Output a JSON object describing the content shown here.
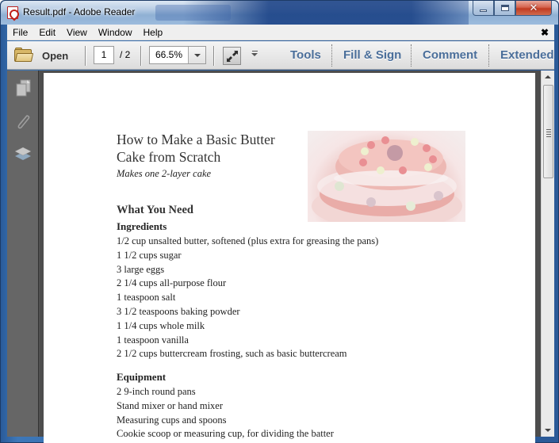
{
  "window": {
    "title": "Result.pdf - Adobe Reader",
    "controls": {
      "minimize": "minimize",
      "maximize": "maximize",
      "close": "✕"
    }
  },
  "menubar": {
    "items": [
      "File",
      "Edit",
      "View",
      "Window",
      "Help"
    ],
    "close_doc": "✖"
  },
  "toolbar": {
    "open_label": "Open",
    "page_current": "1",
    "page_total": "/ 2",
    "zoom_value": "66.5%",
    "pane_tabs": [
      "Tools",
      "Fill & Sign",
      "Comment",
      "Extended"
    ]
  },
  "colors": {
    "pane_tab": "#4a6e9a",
    "workarea_bg": "#525252",
    "rail_bg": "#666666"
  },
  "document": {
    "title": "How to Make a Basic Butter Cake from Scratch",
    "subtitle": "Makes one 2-layer cake",
    "section": "What You Need",
    "ingredients_heading": "Ingredients",
    "ingredients": [
      "1/2 cup unsalted butter, softened (plus extra for greasing the pans)",
      "1 1/2 cups sugar",
      "3 large eggs",
      "2 1/4 cups all-purpose flour",
      "1 teaspoon salt",
      "3 1/2 teaspoons baking powder",
      "1 1/4 cups whole milk",
      "1 teaspoon vanilla",
      "2 1/2 cups buttercream frosting, such as basic buttercream"
    ],
    "equipment_heading": "Equipment",
    "equipment": [
      "2 9-inch round pans",
      "Stand mixer or hand mixer",
      "Measuring cups and spoons",
      "Cookie scoop or measuring cup, for dividing the batter"
    ],
    "image_alt": "pink tiered cake with lace and flowers"
  },
  "sidebar": {
    "icons": [
      "pages-icon",
      "attachments-icon",
      "layers-icon"
    ]
  }
}
